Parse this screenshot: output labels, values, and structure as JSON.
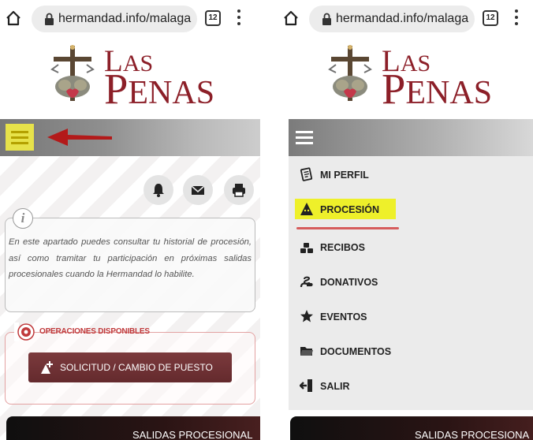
{
  "browser": {
    "url": "hermandad.info/malaga",
    "tab_count": "12"
  },
  "logo": {
    "line1_initial": "L",
    "line1_rest": "AS",
    "line2_initial": "P",
    "line2_rest": "ENAS"
  },
  "left": {
    "info_text": "En este apartado puedes consultar tu historial de procesión, así como tramitar tu participación en próximas salidas procesionales cuando la Hermandad lo habilite.",
    "ops_title": "OPERACIONES DISPONIBLES",
    "request_button": "SOLICITUD / CAMBIO DE PUESTO",
    "banner": "SALIDAS PROCESIONAL"
  },
  "right": {
    "menu": [
      {
        "label": "MI PERFIL",
        "icon": "profile-icon"
      },
      {
        "label": "PROCESIÓN",
        "icon": "hood-icon"
      },
      {
        "label": "RECIBOS",
        "icon": "coins-icon"
      },
      {
        "label": "DONATIVOS",
        "icon": "donation-icon"
      },
      {
        "label": "EVENTOS",
        "icon": "star-icon"
      },
      {
        "label": "DOCUMENTOS",
        "icon": "folder-icon"
      },
      {
        "label": "SALIR",
        "icon": "exit-icon"
      }
    ],
    "banner": "SALIDAS PROCESIONA"
  },
  "colors": {
    "brand": "#8c1f28",
    "highlight": "#eef02a",
    "arrow": "#b31a1a",
    "button": "#6e2f32"
  }
}
